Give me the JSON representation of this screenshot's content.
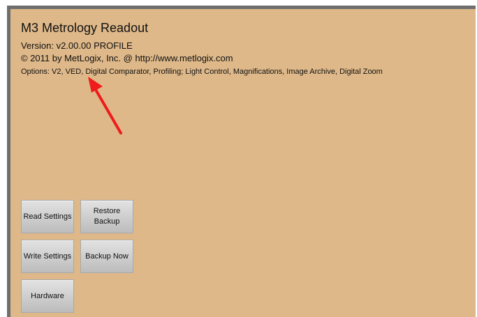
{
  "header": {
    "title": "M3 Metrology Readout",
    "version": "Version: v2.00.00 PROFILE",
    "copyright": "© 2011 by MetLogix, Inc. @ http://www.metlogix.com",
    "options": "Options: V2, VED, Digital Comparator, Profiling; Light Control, Magnifications, Image Archive, Digital Zoom"
  },
  "buttons": {
    "read_settings": "Read Settings",
    "restore_backup": "Restore\nBackup",
    "write_settings": "Write Settings",
    "backup_now": "Backup Now",
    "hardware": "Hardware"
  },
  "colors": {
    "panel_background": "#deb889",
    "frame": "#6e6e6e",
    "annotation_arrow": "#ee1c1c"
  },
  "annotation": {
    "icon": "arrow-icon",
    "points_to": "header.options"
  }
}
